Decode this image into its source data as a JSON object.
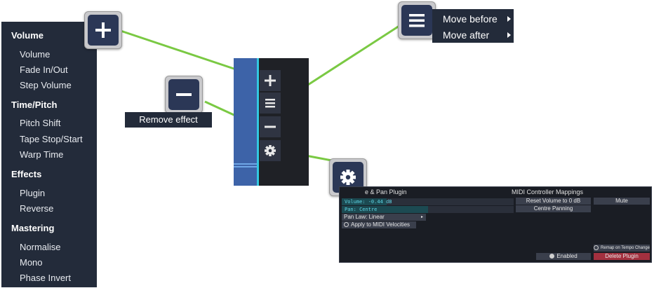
{
  "effects_menu": {
    "categories": [
      {
        "label": "Volume",
        "items": [
          "Volume",
          "Fade In/Out",
          "Step Volume"
        ]
      },
      {
        "label": "Time/Pitch",
        "items": [
          "Pitch Shift",
          "Tape Stop/Start",
          "Warp Time"
        ]
      },
      {
        "label": "Effects",
        "items": [
          "Plugin",
          "Reverse"
        ]
      },
      {
        "label": "Mastering",
        "items": [
          "Normalise",
          "Mono",
          "Phase Invert"
        ]
      }
    ]
  },
  "strip_buttons": [
    {
      "icon": "plus-icon"
    },
    {
      "icon": "list-icon"
    },
    {
      "icon": "minus-icon"
    },
    {
      "icon": "gear-icon"
    }
  ],
  "tooltip": {
    "text": "Remove effect"
  },
  "context_menu": {
    "items": [
      "Move before",
      "Move after"
    ]
  },
  "plugin_panel": {
    "title": "e & Pan Plugin",
    "mapping_header": "MIDI Controller Mappings",
    "volume_field": "Volume: -0.44 dB",
    "volume_level": 0.26,
    "pan_field": "Pan: Centre",
    "pan_level": 0.5,
    "pan_law": "Pan Law: Linear",
    "apply_midi": "Apply to MIDI Velocities",
    "reset_volume": "Reset Volume to 0 dB",
    "centre_panning": "Centre Panning",
    "mute": "Mute",
    "remap": "Remap on Tempo Change",
    "enabled": "Enabled",
    "delete_plugin": "Delete Plugin"
  },
  "colors": {
    "menu_bg": "#232b3a",
    "accent_cyan": "#33c8e0",
    "arrow_green": "#7ac943",
    "delete_red": "#a3303f"
  }
}
